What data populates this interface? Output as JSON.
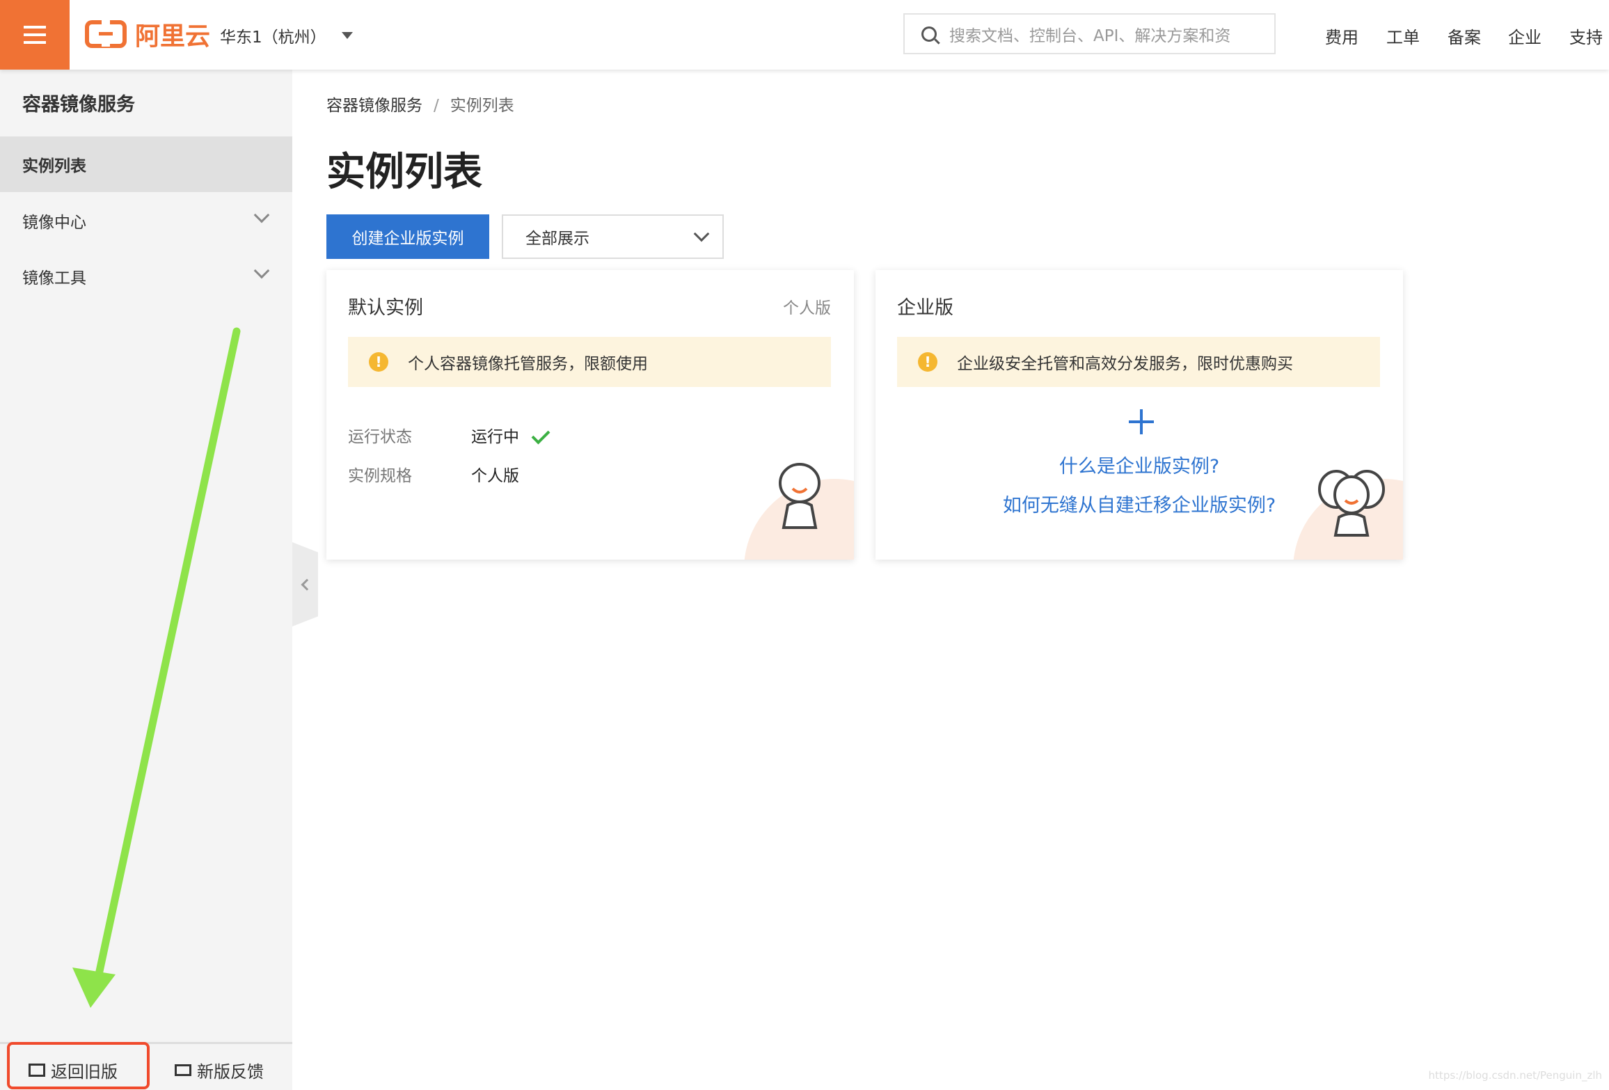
{
  "header": {
    "region": "华东1（杭州）",
    "logo_text": "阿里云",
    "search_placeholder": "搜索文档、控制台、API、解决方案和资",
    "nav": [
      "费用",
      "工单",
      "备案",
      "企业",
      "支持"
    ]
  },
  "sidebar": {
    "title": "容器镜像服务",
    "items": [
      {
        "label": "实例列表",
        "active": true
      },
      {
        "label": "镜像中心"
      },
      {
        "label": "镜像工具"
      }
    ],
    "footer": {
      "back": "返回旧版",
      "feedback": "新版反馈"
    }
  },
  "main": {
    "breadcrumb": [
      "容器镜像服务",
      "实例列表"
    ],
    "title": "实例列表",
    "create_button": "创建企业版实例",
    "filter_value": "全部展示",
    "cards": [
      {
        "title": "默认实例",
        "tag": "个人版",
        "alert": "个人容器镜像托管服务，限额使用",
        "rows": [
          {
            "label": "运行状态",
            "value": "运行中"
          },
          {
            "label": "实例规格",
            "value": "个人版"
          }
        ]
      },
      {
        "title": "企业版",
        "alert": "企业级安全托管和高效分发服务，限时优惠购买",
        "links": [
          "什么是企业版实例?",
          "如何无缝从自建迁移企业版实例?"
        ]
      }
    ]
  },
  "watermark": "https://blog.csdn.net/Penguin_zlh",
  "colors": {
    "brand": "#f07234",
    "primary": "#2e74d0",
    "annotation_arrow": "#8ee34a",
    "annotation_box": "#f04a2c"
  }
}
